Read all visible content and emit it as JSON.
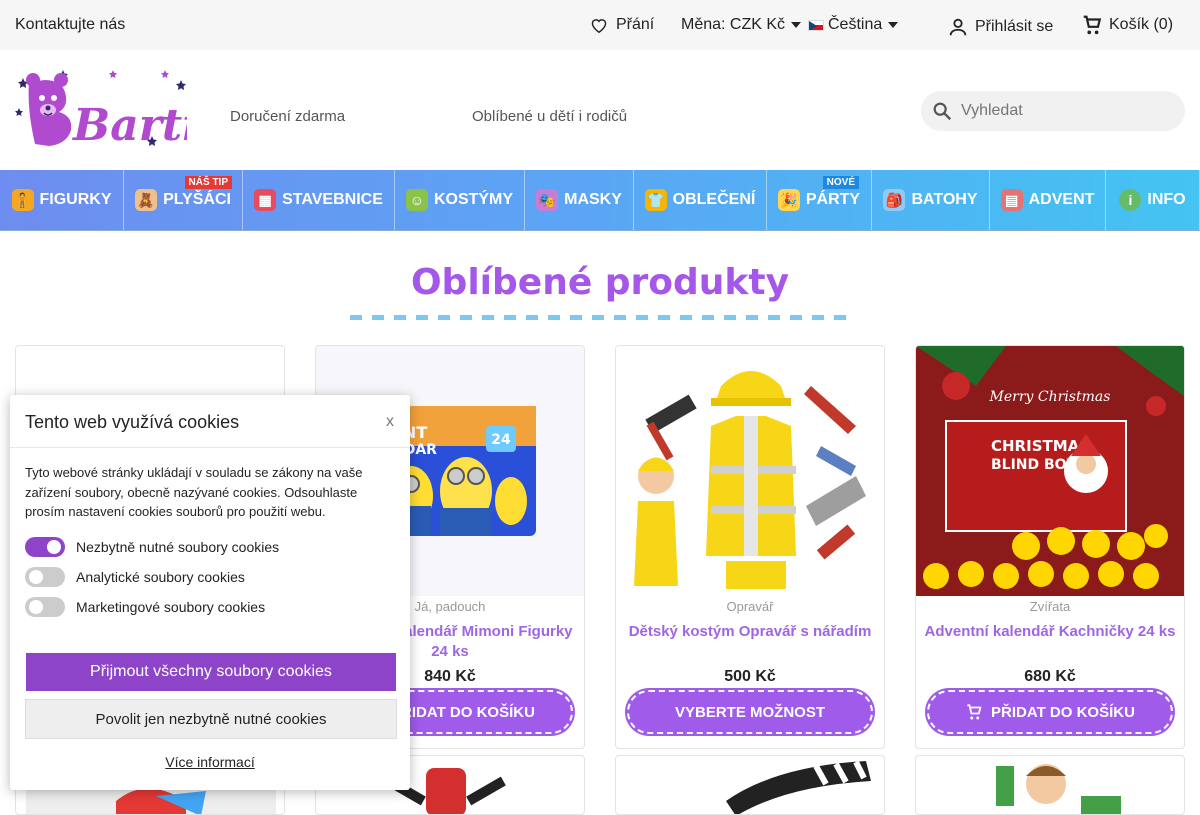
{
  "topbar": {
    "contact": "Kontaktujte nás",
    "wishlist": "Přání",
    "currency": "Měna: CZK Kč",
    "language": "Čeština",
    "login": "Přihlásit se",
    "cart": "Košík (0)"
  },
  "header": {
    "logo_text": "Bartis",
    "link_free_delivery": "Doručení zdarma",
    "link_favorite": "Oblíbené u dětí i rodičů",
    "search_placeholder": "Vyhledat"
  },
  "nav": {
    "items": [
      {
        "label": "FIGURKY",
        "icon": "figure-icon"
      },
      {
        "label": "PLYŠÁCI",
        "icon": "teddy-icon",
        "badge": "NÁŠ TIP"
      },
      {
        "label": "STAVEBNICE",
        "icon": "bricks-icon"
      },
      {
        "label": "KOSTÝMY",
        "icon": "costume-icon"
      },
      {
        "label": "MASKY",
        "icon": "mask-icon"
      },
      {
        "label": "OBLEČENÍ",
        "icon": "clothes-icon"
      },
      {
        "label": "PÁRTY",
        "icon": "party-icon",
        "badge": "NOVÉ"
      },
      {
        "label": "BATOHY",
        "icon": "backpack-icon"
      },
      {
        "label": "ADVENT",
        "icon": "calendar-icon"
      },
      {
        "label": "INFO",
        "icon": "info-icon"
      }
    ]
  },
  "section": {
    "heading": "Oblíbené produkty"
  },
  "products": [
    {
      "category": "Já, padouch",
      "title": "Adventní kalendář Mimoni Figurky 24 ks",
      "price": "840 Kč",
      "button": "PŘIDAT DO KOŠÍKU"
    },
    {
      "category": "Opravář",
      "title": "Dětský kostým Opravář s nářadím",
      "price": "500 Kč",
      "button": "VYBERTE MOŽNOST"
    },
    {
      "category": "Zvířata",
      "title": "Adventní kalendář Kachničky 24 ks",
      "price": "680 Kč",
      "button": "PŘIDAT DO KOŠÍKU"
    }
  ],
  "product_images": {
    "minions_calendar_text": "ENT\nNDAR",
    "minions_count": "24",
    "duck_calendar_text": "CHRISTMAS\nBLIND BOX",
    "duck_calendar_script": "Merry Christmas"
  },
  "cookie": {
    "title": "Tento web využívá cookies",
    "close": "x",
    "text": "Tyto webové stránky ukládají v souladu se zákony na vaše zařízení soubory, obecně nazývané cookies. Odsouhlaste prosím nastavení cookies souborů pro použití webu.",
    "options": [
      {
        "label": "Nezbytně nutné soubory cookies",
        "enabled": true
      },
      {
        "label": "Analytické soubory cookies",
        "enabled": false
      },
      {
        "label": "Marketingové soubory cookies",
        "enabled": false
      }
    ],
    "accept_all": "Přijmout všechny soubory cookies",
    "accept_necessary": "Povolit jen nezbytně nutné cookies",
    "more_info": "Více informací"
  },
  "colors": {
    "accent": "#a05bea",
    "heading": "#a457e8",
    "toggle_on": "#8e44c9",
    "toggle_off": "#cccccc"
  }
}
